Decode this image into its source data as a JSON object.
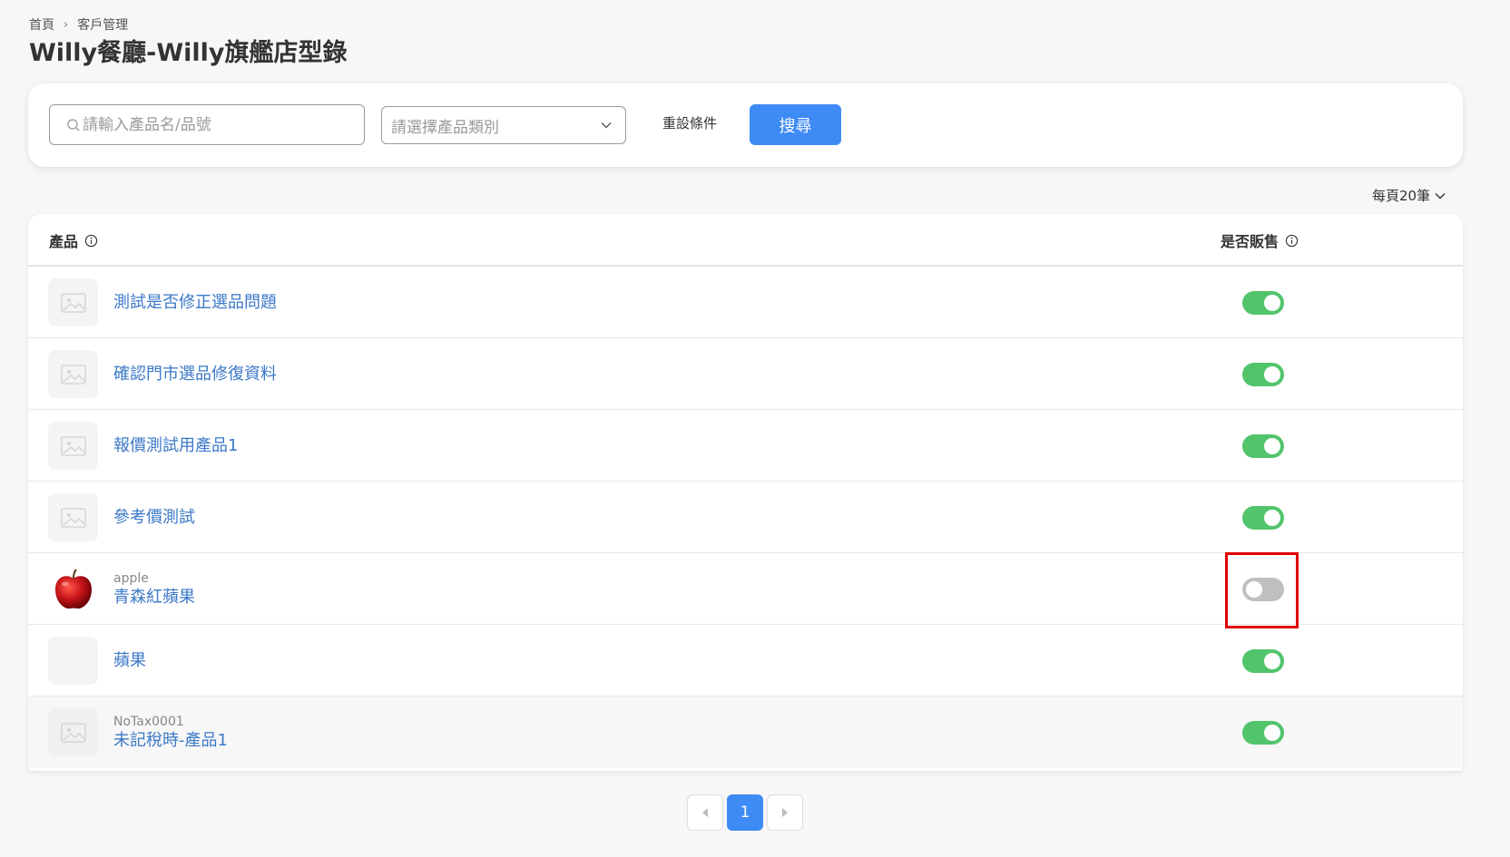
{
  "breadcrumb": {
    "home": "首頁",
    "current": "客戶管理"
  },
  "page_title": "Willy餐廳-Willy旗艦店型錄",
  "filters": {
    "search_placeholder": "請輸入產品名/品號",
    "category_placeholder": "請選擇產品類別",
    "reset_label": "重設條件",
    "search_label": "搜尋"
  },
  "page_size_label": "每頁20筆",
  "table": {
    "col_product": "產品",
    "col_for_sale": "是否販售",
    "rows": [
      {
        "sku": "",
        "name": "測試是否修正選品問題",
        "for_sale": true,
        "thumb": "placeholder-image"
      },
      {
        "sku": "",
        "name": "確認門市選品修復資料",
        "for_sale": true,
        "thumb": "placeholder-image"
      },
      {
        "sku": "",
        "name": "報價測試用產品1",
        "for_sale": true,
        "thumb": "placeholder-image"
      },
      {
        "sku": "",
        "name": "參考價測試",
        "for_sale": true,
        "thumb": "placeholder-image"
      },
      {
        "sku": "apple",
        "name": "青森紅蘋果",
        "for_sale": false,
        "thumb": "apple-image"
      },
      {
        "sku": "",
        "name": "蘋果",
        "for_sale": true,
        "thumb": "blank"
      },
      {
        "sku": "NoTax0001",
        "name": "未記稅時-產品1",
        "for_sale": true,
        "thumb": "placeholder-image"
      }
    ]
  },
  "pagination": {
    "current_page": "1"
  },
  "colors": {
    "accent": "#3f8bf5",
    "toggle_on": "#52c46b",
    "toggle_off": "#bfbfbf",
    "link": "#3b78c7",
    "highlight": "#e00000"
  }
}
